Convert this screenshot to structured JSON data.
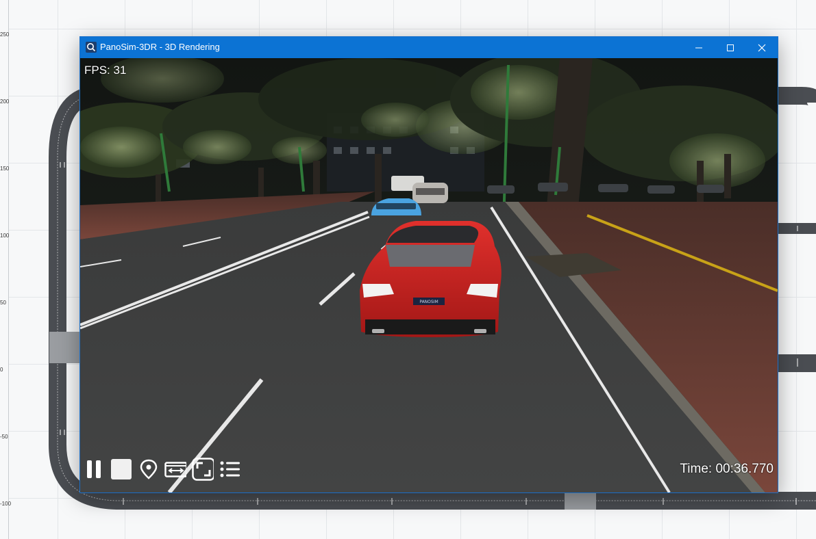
{
  "window": {
    "title": "PanoSim-3DR - 3D Rendering",
    "controls": [
      "minimize",
      "maximize",
      "close"
    ],
    "accent": "#0c73d4"
  },
  "viewport": {
    "fps_label": "FPS: 31",
    "time_label": "Time: 00:36.770",
    "car_plate": "PANOSIM"
  },
  "toolbar": {
    "buttons": [
      {
        "icon": "pause-icon"
      },
      {
        "icon": "stop-icon"
      },
      {
        "icon": "location-pin-icon"
      },
      {
        "icon": "swap-horizontal-icon"
      },
      {
        "icon": "fullscreen-icon"
      },
      {
        "icon": "list-icon"
      }
    ]
  },
  "background": {
    "ruler_ticks": [
      "250",
      "200",
      "150",
      "100",
      "50",
      "0",
      "-50",
      "-100"
    ]
  }
}
